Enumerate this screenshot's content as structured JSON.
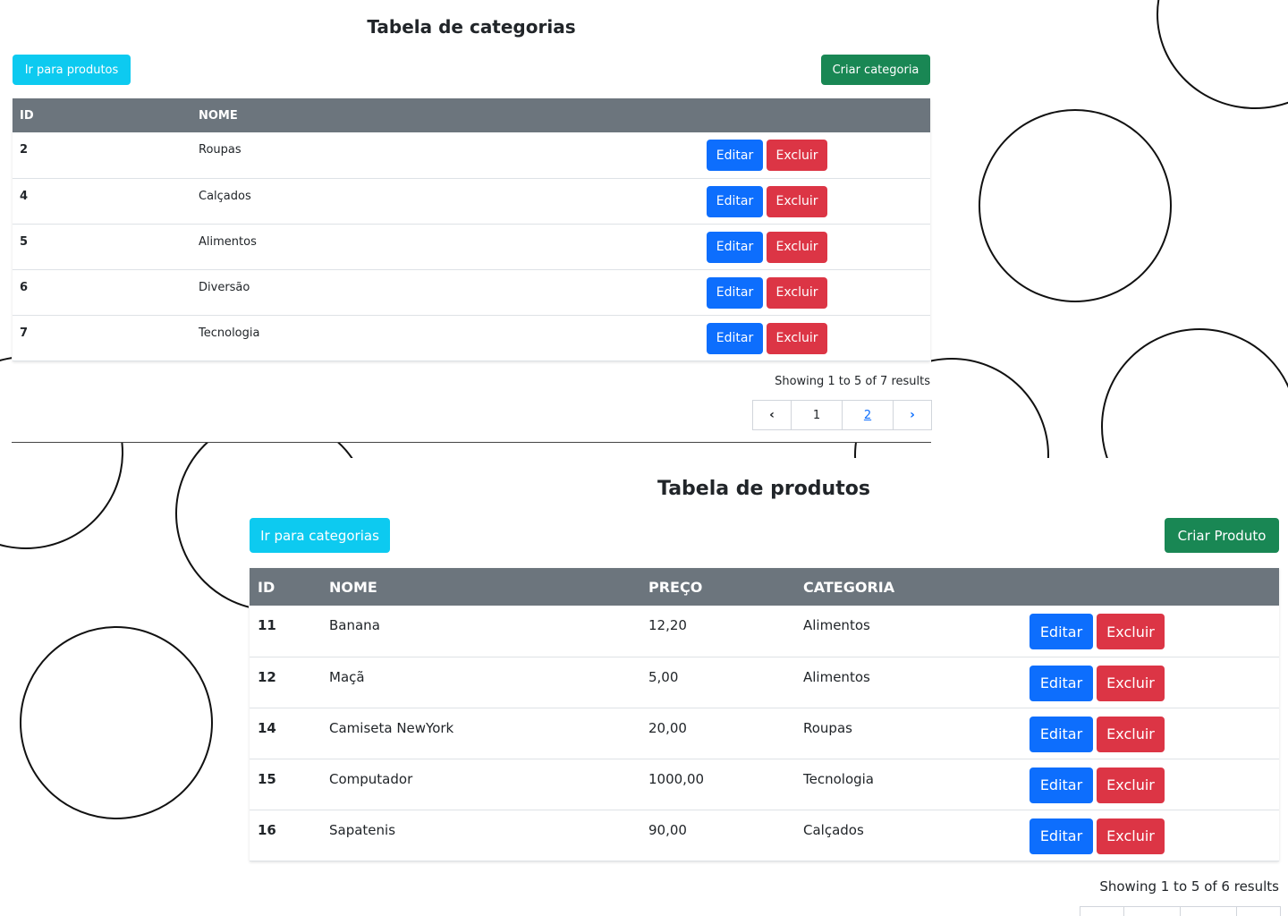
{
  "categories": {
    "title": "Tabela de categorias",
    "nav_button": "Ir para produtos",
    "create_button": "Criar categoria",
    "columns": [
      "ID",
      "NOME"
    ],
    "rows": [
      {
        "id": "2",
        "nome": "Roupas"
      },
      {
        "id": "4",
        "nome": "Calçados"
      },
      {
        "id": "5",
        "nome": "Alimentos"
      },
      {
        "id": "6",
        "nome": "Diversão"
      },
      {
        "id": "7",
        "nome": "Tecnologia"
      }
    ],
    "edit_label": "Editar",
    "delete_label": "Excluir",
    "summary": "Showing 1 to 5 of 7 results",
    "pages": [
      "1",
      "2"
    ],
    "prev_icon": "‹",
    "next_icon": "›"
  },
  "products": {
    "title": "Tabela de produtos",
    "nav_button": "Ir para categorias",
    "create_button": "Criar Produto",
    "columns": [
      "ID",
      "NOME",
      "PREÇO",
      "CATEGORIA"
    ],
    "rows": [
      {
        "id": "11",
        "nome": "Banana",
        "preco": "12,20",
        "categoria": "Alimentos"
      },
      {
        "id": "12",
        "nome": "Maçã",
        "preco": "5,00",
        "categoria": "Alimentos"
      },
      {
        "id": "14",
        "nome": "Camiseta NewYork",
        "preco": "20,00",
        "categoria": "Roupas"
      },
      {
        "id": "15",
        "nome": "Computador",
        "preco": "1000,00",
        "categoria": "Tecnologia"
      },
      {
        "id": "16",
        "nome": "Sapatenis",
        "preco": "90,00",
        "categoria": "Calçados"
      }
    ],
    "edit_label": "Editar",
    "delete_label": "Excluir",
    "summary": "Showing 1 to 5 of 6 results"
  },
  "colors": {
    "info": "#0dcaf0",
    "success": "#198754",
    "primary": "#0d6efd",
    "danger": "#dc3545",
    "table_header": "#6c757d"
  }
}
